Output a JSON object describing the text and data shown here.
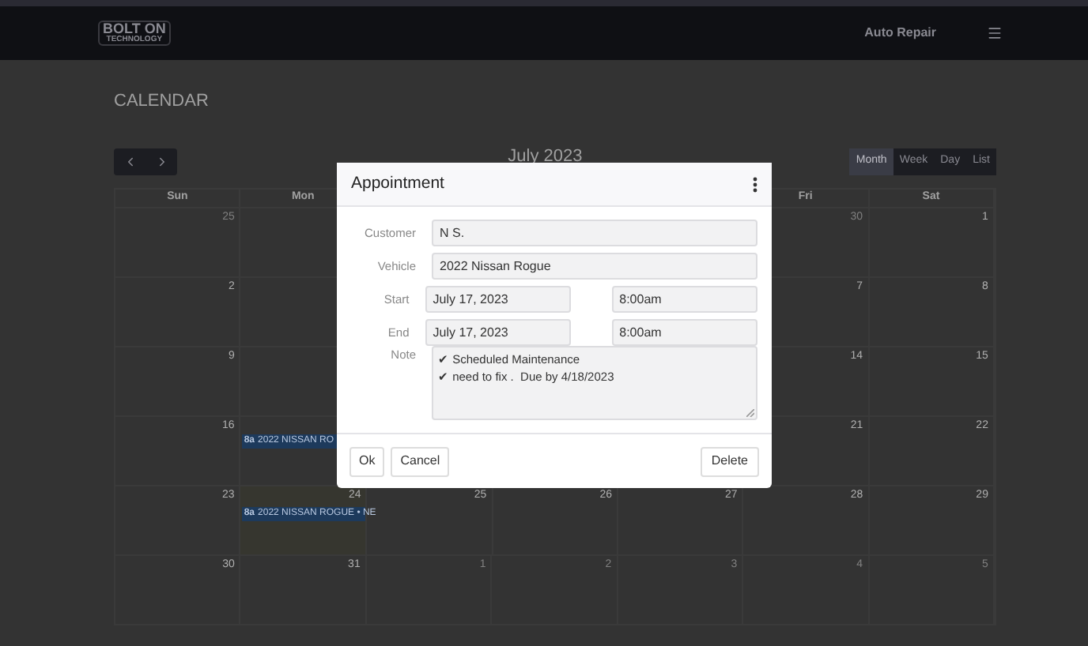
{
  "header": {
    "logo_top": "BOLT ON",
    "logo_bottom": "TECHNOLOGY",
    "title": "Auto Repair"
  },
  "page_title": "CALENDAR",
  "toolbar": {
    "title": "July 2023",
    "views": [
      {
        "label": "Month",
        "selected": true
      },
      {
        "label": "Week",
        "selected": false
      },
      {
        "label": "Day",
        "selected": false
      },
      {
        "label": "List",
        "selected": false
      }
    ]
  },
  "calendar": {
    "weekdays": {
      "sun_mon": [
        "Sun",
        "Mon"
      ],
      "fri_sat": [
        "Fri",
        "Sat"
      ]
    },
    "weeks": [
      {
        "sun_mon": [
          {
            "day": "25",
            "other_month": true
          }
        ],
        "fri_sat": [
          {
            "day": "30",
            "other_month": true
          },
          {
            "day": "1",
            "other_month": false
          }
        ]
      },
      {
        "sun_mon": [
          {
            "day": "2",
            "other_month": false
          }
        ],
        "fri_sat": [
          {
            "day": "7",
            "other_month": false
          },
          {
            "day": "8",
            "other_month": false
          }
        ]
      },
      {
        "sun_mon": [
          {
            "day": "9",
            "other_month": false
          }
        ],
        "fri_sat": [
          {
            "day": "14",
            "other_month": false
          },
          {
            "day": "15",
            "other_month": false
          }
        ]
      },
      {
        "sun_mon": [
          {
            "day": "16",
            "other_month": false
          },
          {
            "events": [
              {
                "time": "8a",
                "title": "2022 NISSAN RO"
              }
            ]
          }
        ],
        "fri_sat": [
          {
            "day": "21",
            "other_month": false
          },
          {
            "day": "22",
            "other_month": false
          }
        ]
      },
      {
        "sun_mon": [
          {
            "day": "23",
            "other_month": false
          },
          {
            "day": "24",
            "other_month": false,
            "today": true,
            "events": [
              {
                "time": "8a",
                "title": "2022 NISSAN ROGUE • NE"
              }
            ]
          }
        ],
        "tue_thu": [
          {
            "day": "25",
            "other_month": false
          },
          {
            "day": "26",
            "other_month": false
          },
          {
            "day": "27",
            "other_month": false
          }
        ],
        "fri_sat": [
          {
            "day": "28",
            "other_month": false
          },
          {
            "day": "29",
            "other_month": false
          }
        ]
      },
      {
        "sun_mon": [
          {
            "day": "30",
            "other_month": false
          },
          {
            "day": "31",
            "other_month": false
          }
        ],
        "tue_thu": [
          {
            "day": "1",
            "other_month": true
          },
          {
            "day": "2",
            "other_month": true
          },
          {
            "day": "3",
            "other_month": true
          }
        ],
        "fri_sat": [
          {
            "day": "4",
            "other_month": true
          },
          {
            "day": "5",
            "other_month": true
          }
        ]
      }
    ]
  },
  "dialog": {
    "title": "Appointment",
    "customer_label": "Customer",
    "customer": "N     S.",
    "vehicle_label": "Vehicle",
    "vehicle": "2022 Nissan Rogue",
    "start_label": "Start",
    "start_date": "July 17, 2023",
    "start_time": "8:00am",
    "end_label": "End",
    "end_date": "July 17, 2023",
    "end_time": "8:00am",
    "note_label": "Note",
    "note": [
      "✔ Scheduled Maintenance",
      "✔ need to fix .  Due by 4/18/2023"
    ],
    "buttons": [
      "Ok",
      "Cancel"
    ],
    "delete_button": "Delete"
  }
}
